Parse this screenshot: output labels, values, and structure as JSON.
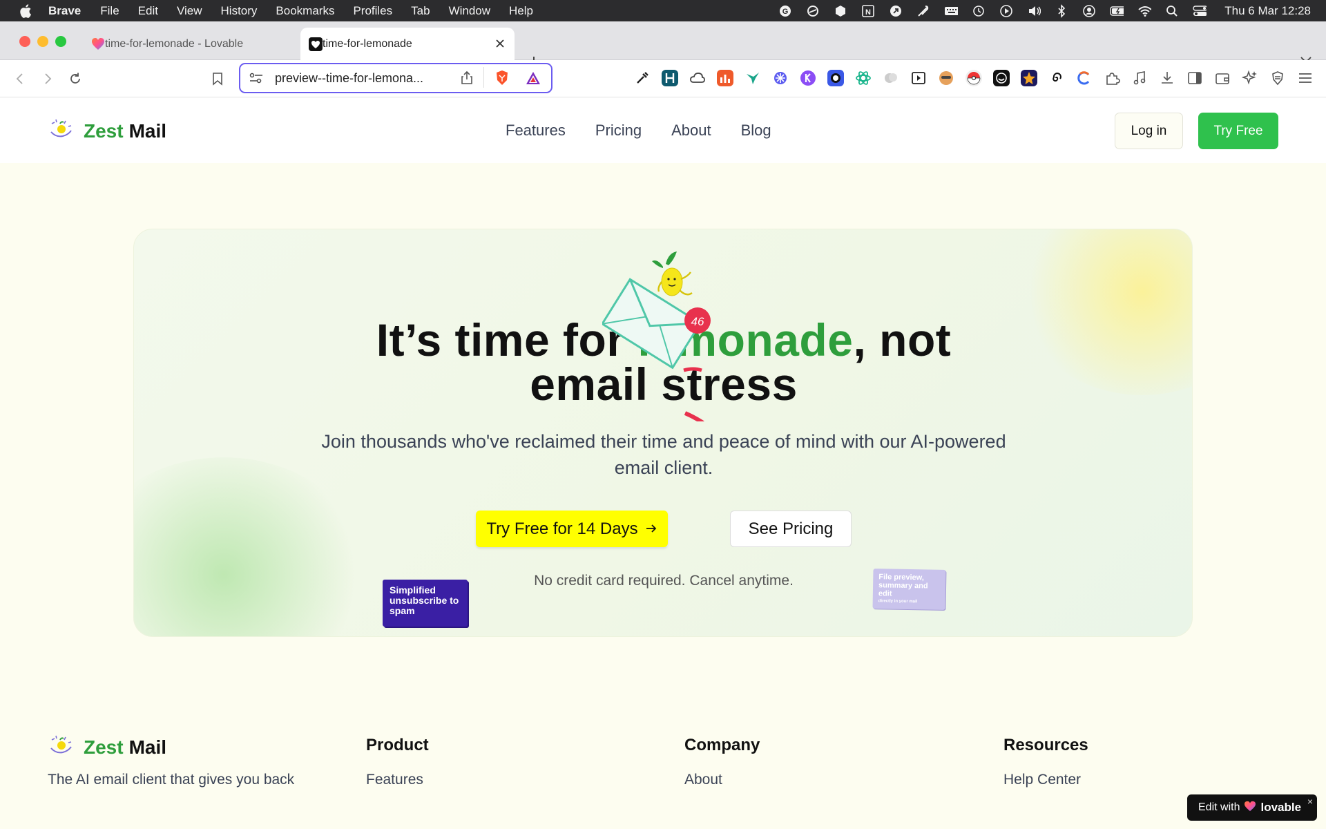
{
  "menubar": {
    "app_name": "Brave",
    "items": [
      "File",
      "Edit",
      "View",
      "History",
      "Bookmarks",
      "Profiles",
      "Tab",
      "Window",
      "Help"
    ],
    "clock": "Thu 6 Mar  12:28"
  },
  "browser": {
    "tabs": [
      {
        "title": "time-for-lemonade - Lovable",
        "active": false
      },
      {
        "title": "time-for-lemonade",
        "active": true
      }
    ],
    "address": "preview--time-for-lemona..."
  },
  "nav": {
    "brand_zest": "Zest",
    "brand_mail": "Mail",
    "links": [
      "Features",
      "Pricing",
      "About",
      "Blog"
    ],
    "login": "Log in",
    "try_free": "Try Free"
  },
  "hero": {
    "headline_a": "It’s time for ",
    "headline_green": "lemonade",
    "headline_b": ", not",
    "headline_line2": "email stress",
    "subtitle": "Join thousands who've reclaimed their time and peace of mind with our AI-powered email client.",
    "cta_primary": "Try Free for 14 Days",
    "cta_secondary": "See Pricing",
    "note": "No credit card required. Cancel anytime.",
    "sticker_left": "Simplified unsubscribe to spam",
    "sticker_right": "File preview, summary and edit",
    "sticker_right_small": "directly in your mail",
    "badge_count": "46"
  },
  "footer": {
    "brand_zest": "Zest",
    "brand_mail": "Mail",
    "tagline": "The AI email client that gives you back",
    "columns": [
      {
        "title": "Product",
        "first_link": "Features"
      },
      {
        "title": "Company",
        "first_link": "About"
      },
      {
        "title": "Resources",
        "first_link": "Help Center"
      }
    ]
  },
  "lovable_badge": {
    "edit_with": "Edit with",
    "brand": "lovable",
    "close": "×"
  },
  "colors": {
    "brand_green": "#2e9e3c",
    "cta_yellow": "#ffff00",
    "try_green": "#2fc14d",
    "address_focus": "#6b5cf0"
  }
}
